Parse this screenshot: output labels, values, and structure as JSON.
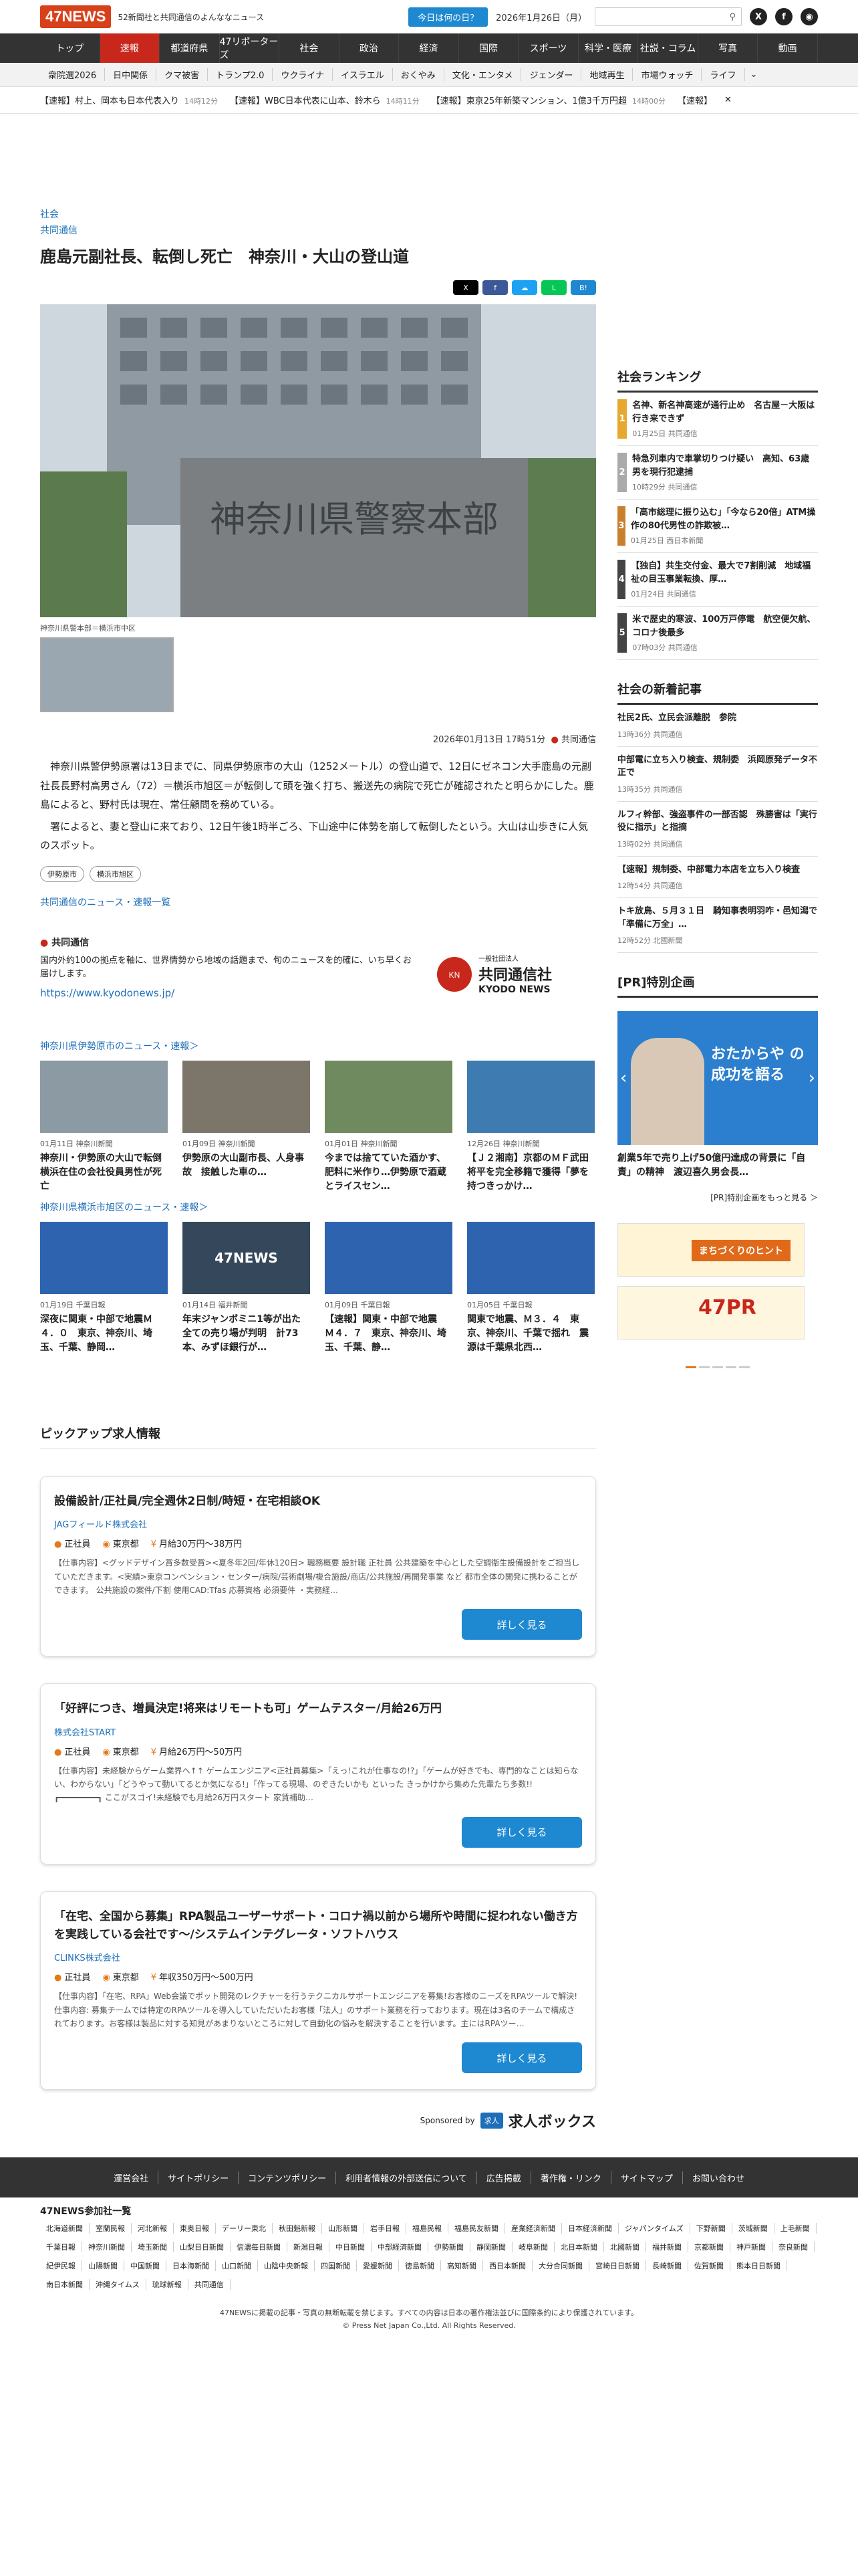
{
  "header": {
    "logo": "47NEWS",
    "tagline": "52新聞社と共同通信のよんななニュース",
    "today_button": "今日は何の日？",
    "date": "2026年1月26日（月）",
    "search_icon": "search-icon"
  },
  "nav": [
    "トップ",
    "速報",
    "都道府県",
    "47リポーターズ",
    "社会",
    "政治",
    "経済",
    "国際",
    "スポーツ",
    "科学・医療",
    "社説・コラム",
    "写真",
    "動画"
  ],
  "subnav": [
    "衆院選2026",
    "日中関係",
    "クマ被害",
    "トランプ2.0",
    "ウクライナ",
    "イスラエル",
    "おくやみ",
    "文化・エンタメ",
    "ジェンダー",
    "地域再生",
    "市場ウォッチ",
    "ライフ"
  ],
  "ticker": [
    {
      "text": "【速報】村上、岡本も日本代表入り",
      "time": "14時12分"
    },
    {
      "text": "【速報】WBC日本代表に山本、鈴木ら",
      "time": "14時11分"
    },
    {
      "text": "【速報】東京25年新築マンション、1億3千万円超",
      "time": "14時00分"
    },
    {
      "text": "【速報】",
      "time": ""
    }
  ],
  "article": {
    "category": "社会",
    "source": "共同通信",
    "title": "鹿島元副社長、転倒し死亡　神奈川・大山の登山道",
    "photo_caption": "神奈川県警本部＝横浜市中区",
    "sign_text": "神奈川県警察本部",
    "datetime": "2026年01月13日 17時51分",
    "meta_source": "共同通信",
    "paragraphs": [
      "神奈川県警伊勢原署は13日までに、同県伊勢原市の大山（1252メートル）の登山道で、12日にゼネコン大手鹿島の元副社長長野村高男さん（72）＝横浜市旭区＝が転倒して頭を強く打ち、搬送先の病院で死亡が確認されたと明らかにした。鹿島によると、野村氏は現在、常任顧問を務めている。",
      "署によると、妻と登山に来ており、12日午後1時半ごろ、下山途中に体勢を崩して転倒したという。大山は山歩きに人気のスポット。"
    ],
    "tags": [
      "伊勢原市",
      "横浜市旭区"
    ],
    "more_link": "共同通信のニュース・速報一覧"
  },
  "kyodo": {
    "title": "共同通信",
    "desc": "国内外約100の拠点を軸に、世界情勢から地域の話題まで、旬のニュースを的確に、いち早くお届けします。",
    "url": "https://www.kyodonews.jp/",
    "logo_text": "共同通信社",
    "logo_sub": "KYODO NEWS",
    "logo_org": "一般社団法人"
  },
  "section1": {
    "title": "神奈川県伊勢原市のニュース・速報＞",
    "cards": [
      {
        "meta": "01月11日 神奈川新聞",
        "title": "神奈川・伊勢原の大山で転倒　横浜在住の会社役員男性が死亡"
      },
      {
        "meta": "01月09日 神奈川新聞",
        "title": "伊勢原の大山副市長、人身事故　接触した車の…"
      },
      {
        "meta": "01月01日 神奈川新聞",
        "title": "今までは捨てていた酒かす、肥料に米作り…伊勢原で酒蔵とライスセン…"
      },
      {
        "meta": "12月26日 神奈川新聞",
        "title": "【Ｊ２湘南】京都のＭＦ武田将平を完全移籍で獲得「夢を持つきっかけ…"
      }
    ]
  },
  "section2": {
    "title": "神奈川県横浜市旭区のニュース・速報＞",
    "cards": [
      {
        "meta": "01月19日 千葉日報",
        "title": "深夜に関東・中部で地震Ｍ４．０　東京、神奈川、埼玉、千葉、静岡…"
      },
      {
        "meta": "01月14日 福井新聞",
        "title": "年末ジャンボミニ1等が出た全ての売り場が判明　計73本、みずほ銀行が…"
      },
      {
        "meta": "01月09日 千葉日報",
        "title": "【速報】関東・中部で地震　Ｍ４．７　東京、神奈川、埼玉、千葉、静…"
      },
      {
        "meta": "01月05日 千葉日報",
        "title": "関東で地震、Ｍ３．４　東京、神奈川、千葉で揺れ　震源は千葉県北西…"
      }
    ]
  },
  "jobs": {
    "heading": "ピックアップ求人情報",
    "items": [
      {
        "title": "設備設計/正社員/完全週休2日制/時短・在宅相談OK",
        "company": "JAGフィールド株式会社",
        "type": "正社員",
        "location": "東京都",
        "salary": "月給30万円～38万円",
        "desc": "【仕事内容】<グッドデザイン賞多数受賞><夏冬年2回/年休120日> 職務概要 設計職 正社員 公共建築を中心とした空調衛生設備設計をご担当していただきます。<実績>東京コンベンション・センター/病院/芸術劇場/複合施設/商店/公共施設/再開発事業 など 都市全体の開発に携わることができます。 公共施設の案件/下割 使用CAD:Tfas 応募資格 必須要件 ・実務経…",
        "button": "詳しく見る"
      },
      {
        "title": "「好評につき、増員決定!将来はリモートも可」ゲームテスター/月給26万円",
        "company": "株式会社START",
        "type": "正社員",
        "location": "東京都",
        "salary": "月給26万円～50万円",
        "desc": "【仕事内容】未経験からゲーム業界へ↑↑ ゲームエンジニア<正社員募集>「えっ!これが仕事なの!?」「ゲームが好きでも、専門的なことは知らない、わからない」「どうやって動いてるとか気になる!」「作ってる現場、のぞきたいかも といった きっかけから集めた先輩たち多数!! ┏━━━━━━━━┓ ここがスゴイ!未経験でも月給26万円スタート 家賃補助…",
        "button": "詳しく見る"
      },
      {
        "title": "「在宅、全国から募集」RPA製品ユーザーサポート・コロナ禍以前から場所や時間に捉われない働き方を実践している会社です～/システムインテグレータ・ソフトハウス",
        "company": "CLINKS株式会社",
        "type": "正社員",
        "location": "東京都",
        "salary": "年収350万円～500万円",
        "desc": "【仕事内容】「在宅、RPA」Web会議でポット開発のレクチャーを行うテクニカルサポートエンジニアを募集!お客様のニーズをRPAツールで解決! 仕事内容: 募集チームでは特定のRPAツールを導入していただいたお客様「法人」のサポート業務を行っております。現在は3名のチームで構成されております。お客様は製品に対する知見があまりないところに対して自動化の悩みを解決することを行います。主にはRPAツー…",
        "button": "詳しく見る"
      }
    ],
    "sponsor_label": "Sponsored by",
    "sponsor_badge": "求人",
    "sponsor_name": "求人ボックス"
  },
  "ranking": {
    "heading": "社会ランキング",
    "items": [
      {
        "num": "1",
        "title": "名神、新名神高速が通行止め　名古屋－大阪は行き来できず",
        "meta": "01月25日 共同通信"
      },
      {
        "num": "2",
        "title": "特急列車内で車掌切りつけ疑い　高知、63歳男を現行犯逮捕",
        "meta": "10時29分 共同通信"
      },
      {
        "num": "3",
        "title": "「高市総理に振り込む」「今なら20倍」ATM操作の80代男性の詐欺被…",
        "meta": "01月25日 西日本新聞"
      },
      {
        "num": "4",
        "title": "【独自】共生交付金、最大で7割削減　地域福祉の目玉事業転換、厚…",
        "meta": "01月24日 共同通信"
      },
      {
        "num": "5",
        "title": "米で歴史的寒波、100万戸停電　航空便欠航、コロナ後最多",
        "meta": "07時03分 共同通信"
      }
    ]
  },
  "newest": {
    "heading": "社会の新着記事",
    "items": [
      {
        "title": "社民2氏、立民会派離脱　参院",
        "meta": "13時36分 共同通信"
      },
      {
        "title": "中部電に立ち入り検査、規制委　浜岡原発データ不正で",
        "meta": "13時35分 共同通信"
      },
      {
        "title": "ルフィ幹部、強盗事件の一部否認　殊勝害は「実行役に指示」と指摘",
        "meta": "13時02分 共同通信"
      },
      {
        "title": "【速報】規制委、中部電力本店を立ち入り検査",
        "meta": "12時54分 共同通信"
      },
      {
        "title": "トキ放鳥、５月３１日　騎知事表明羽咋・邑知潟で「準備に万全」…",
        "meta": "12時52分 北國新聞"
      }
    ]
  },
  "pr": {
    "heading": "[PR]特別企画",
    "slide_title": "おたからや の成功を語る",
    "caption": "創業5年で売り上げ50億円達成の背景に「自責」の精神　渡辺喜久男会長…",
    "link": "[PR]特別企画をもっと見る ＞",
    "ad1_text": "まちづくりのヒント",
    "ad2_text": "47PR"
  },
  "footer": {
    "links": [
      "運営会社",
      "サイトポリシー",
      "コンテンツポリシー",
      "利用者情報の外部送信について",
      "広告掲載",
      "著作権・リンク",
      "サイトマップ",
      "お問い合わせ"
    ],
    "partners_heading": "47NEWS参加社一覧",
    "partners": [
      "北海道新聞",
      "室蘭民報",
      "河北新報",
      "東奥日報",
      "デーリー東北",
      "秋田魁新報",
      "山形新聞",
      "岩手日報",
      "福島民報",
      "福島民友新聞",
      "産業経済新聞",
      "日本経済新聞",
      "ジャパンタイムズ",
      "下野新聞",
      "茨城新聞",
      "上毛新聞",
      "千葉日報",
      "神奈川新聞",
      "埼玉新聞",
      "山梨日日新聞",
      "信濃毎日新聞",
      "新潟日報",
      "中日新聞",
      "中部経済新聞",
      "伊勢新聞",
      "静岡新聞",
      "岐阜新聞",
      "北日本新聞",
      "北國新聞",
      "福井新聞",
      "京都新聞",
      "神戸新聞",
      "奈良新聞",
      "紀伊民報",
      "山陽新聞",
      "中国新聞",
      "日本海新聞",
      "山口新聞",
      "山陰中央新報",
      "四国新聞",
      "愛媛新聞",
      "徳島新聞",
      "高知新聞",
      "西日本新聞",
      "大分合同新聞",
      "宮崎日日新聞",
      "長崎新聞",
      "佐賀新聞",
      "熊本日日新聞",
      "南日本新聞",
      "沖縄タイムス",
      "琉球新報",
      "共同通信"
    ],
    "copy1": "47NEWSに掲載の記事・写真の無断転載を禁じます。すべての内容は日本の著作権法並びに国際条約により保護されています。",
    "copy2": "© Press Net Japan Co.,Ltd. All Rights Reserved."
  },
  "colors": {
    "accent": "#c8281c",
    "link": "#1e6fb8",
    "nav": "#333333",
    "button": "#1e88d0",
    "rank": "#e6a82f"
  }
}
